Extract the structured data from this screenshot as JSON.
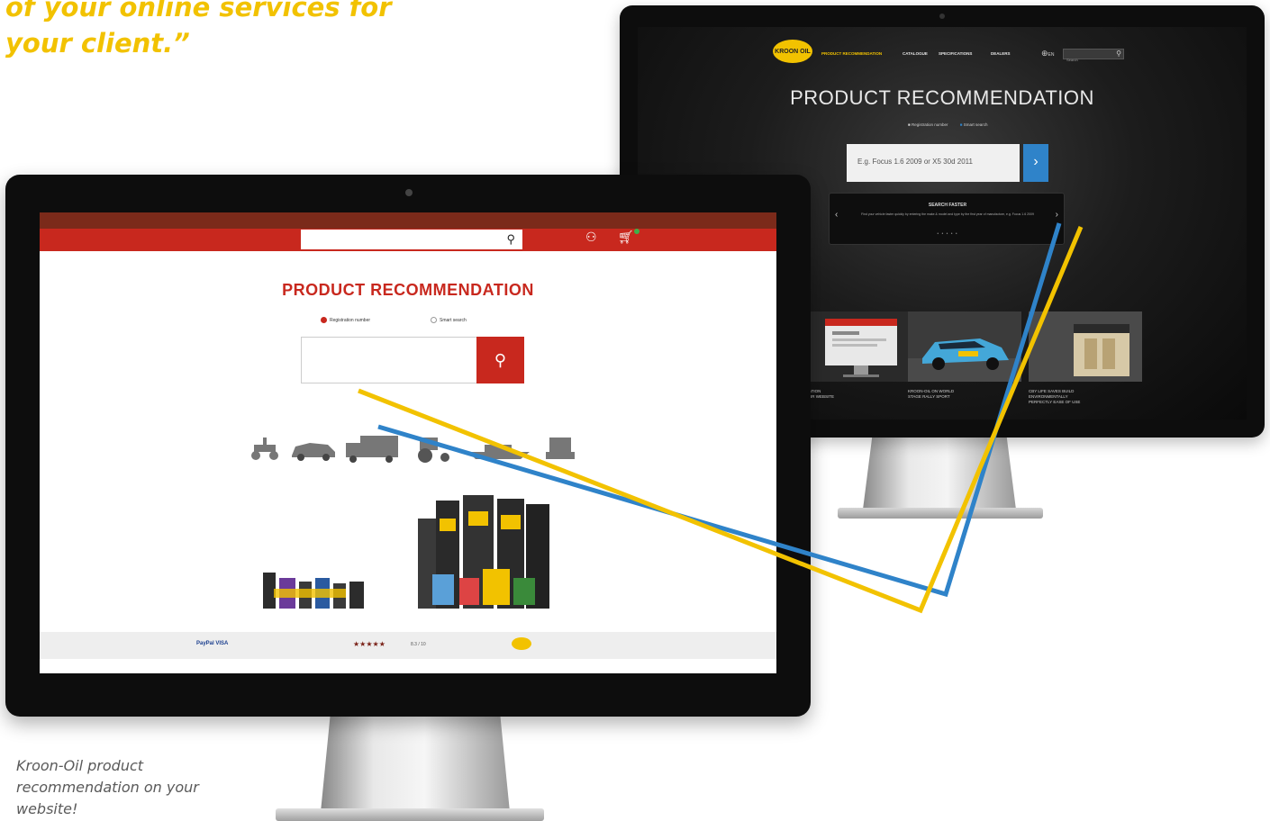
{
  "quote": {
    "line1": "of your online services for",
    "line2": "your client.”"
  },
  "caption": {
    "line1": "Kroon-Oil product",
    "line2": "recommendation on your",
    "line3": "website!"
  },
  "back_site": {
    "logo": "KROON OIL",
    "nav": [
      "PRODUCT RECOMMENDATION",
      "CATALOGUE",
      "SPECIFICATIONS",
      "DEALERS"
    ],
    "language": "EN",
    "search_placeholder": "Search",
    "title": "PRODUCT RECOMMENDATION",
    "radio_options": [
      "Registration number",
      "Smart search"
    ],
    "input_placeholder": "E.g. Focus 1.6 2009 or X5 30d 2011",
    "go_label": "›",
    "panel": {
      "title": "SEARCH FASTER",
      "text": "Find your vehicle faster quickly by entering the make & model and type by the first year of manufacture, e.g. Focus 1.6 2009",
      "dots": "• • • • •"
    },
    "tiles": [
      {
        "caption": "ATION\nUR WEBSITE"
      },
      {
        "caption": "KROON-OIL ON WORLD\nSTAGE RALLY SPORT"
      },
      {
        "caption": "CBY LIFE SAVES BUILD\nENVIRONMENTALLY\nPERFECTLY EASE OF USE"
      }
    ]
  },
  "front_site": {
    "title": "PRODUCT RECOMMENDATION",
    "radio_options": [
      "Registration number",
      "Smart search"
    ],
    "payments": "PayPal  VISA",
    "stars": "★★★★★",
    "rating": "8.3 / 10"
  },
  "colors": {
    "accent_yellow": "#f2c200",
    "accent_blue": "#2f83c9",
    "brand_red": "#c8281e"
  }
}
